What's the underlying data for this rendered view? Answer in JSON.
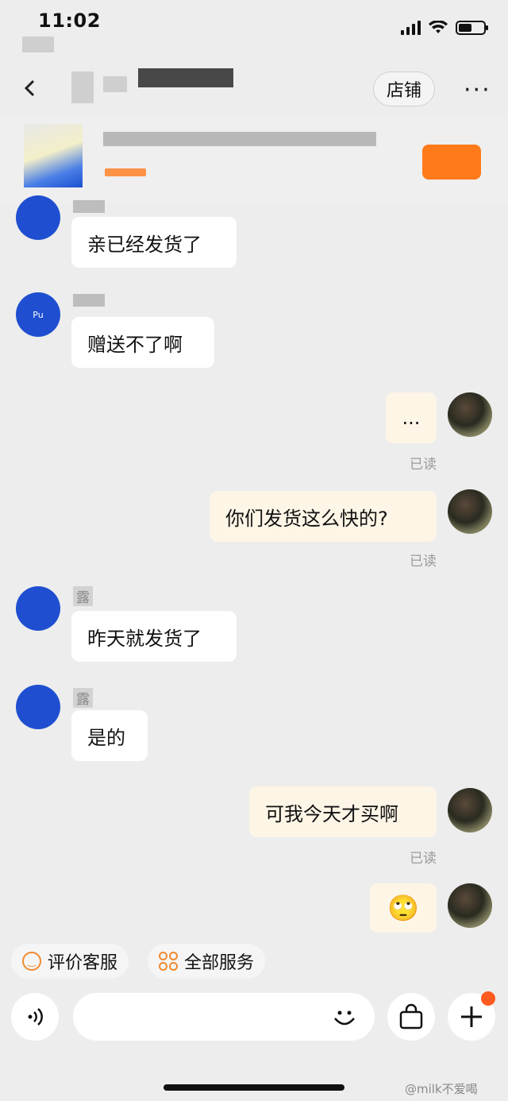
{
  "status_bar": {
    "time": "11:02"
  },
  "header": {
    "shop_label": "店铺",
    "more_label": "···"
  },
  "messages": [
    {
      "side": "left",
      "text": "亲已经发货了"
    },
    {
      "side": "left",
      "text": "赠送不了啊"
    },
    {
      "side": "right",
      "text": "...",
      "read": "已读"
    },
    {
      "side": "right",
      "text": "你们发货这么快的?",
      "read": "已读"
    },
    {
      "side": "left",
      "sender": "露",
      "text": "昨天就发货了"
    },
    {
      "side": "left",
      "sender": "露",
      "text": "是的"
    },
    {
      "side": "right",
      "text": "可我今天才买啊",
      "read": "已读"
    },
    {
      "side": "right",
      "text": "🙄"
    }
  ],
  "quick_actions": [
    {
      "label": "评价客服",
      "icon": "smile-icon"
    },
    {
      "label": "全部服务",
      "icon": "grid-icon"
    }
  ],
  "input": {
    "emoji_icon": "smiley-icon"
  },
  "shop_avatar_text": "Pu",
  "watermark": "@milk不爱喝",
  "colors": {
    "accent": "#ff7a1a",
    "bubble_right": "#fdf5e6",
    "badge": "#ff5a1f"
  }
}
